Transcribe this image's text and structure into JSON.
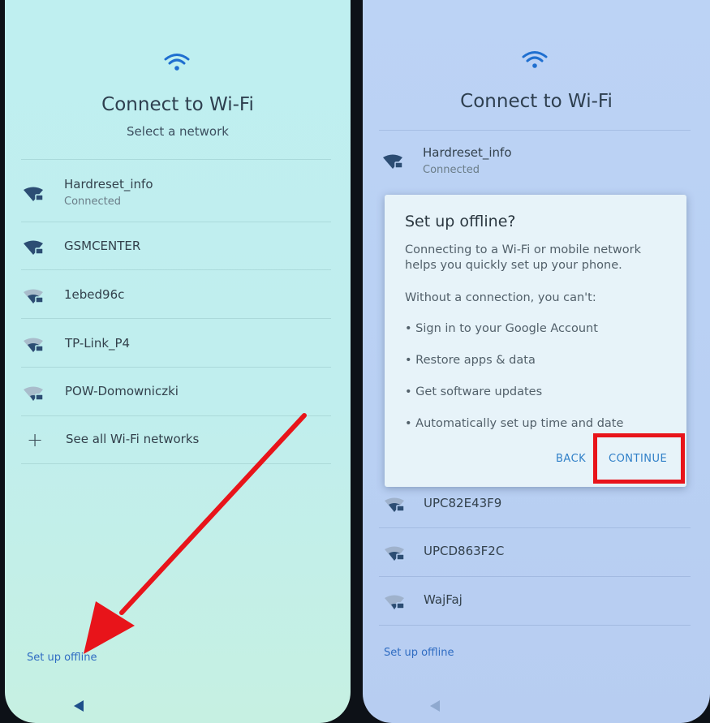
{
  "left_phone": {
    "title": "Connect to Wi-Fi",
    "subtitle": "Select a network",
    "networks": [
      {
        "name": "Hardreset_info",
        "status": "Connected"
      },
      {
        "name": "GSMCENTER",
        "status": ""
      },
      {
        "name": "1ebed96c",
        "status": ""
      },
      {
        "name": "TP-Link_P4",
        "status": ""
      },
      {
        "name": "POW-Domowniczki",
        "status": ""
      }
    ],
    "see_all_label": "See all Wi-Fi networks",
    "setup_offline_label": "Set up offline"
  },
  "right_phone": {
    "title": "Connect to Wi-Fi",
    "networks": [
      {
        "name": "Hardreset_info",
        "status": "Connected"
      },
      {
        "name": "UPC82E43F9",
        "status": ""
      },
      {
        "name": "UPCD863F2C",
        "status": ""
      },
      {
        "name": "WajFaj",
        "status": ""
      }
    ],
    "setup_offline_label": "Set up offline",
    "dialog": {
      "title": "Set up offline?",
      "intro": "Connecting to a Wi-Fi or mobile network helps you quickly set up your phone.",
      "without": "Without a connection, you can't:",
      "bullets": [
        "Sign in to your Google Account",
        "Restore apps & data",
        "Get software updates",
        "Automatically set up time and date"
      ],
      "back_label": "BACK",
      "continue_label": "CONTINUE"
    }
  },
  "colors": {
    "accent_blue": "#2f6cc2",
    "wifi_icon": "#1f6fd0",
    "annotation_red": "#e8141a"
  },
  "icons": {
    "wifi_header": "wifi-icon",
    "network": "wifi-lock-icon",
    "add": "plus-icon",
    "nav_back": "back-triangle-icon"
  }
}
